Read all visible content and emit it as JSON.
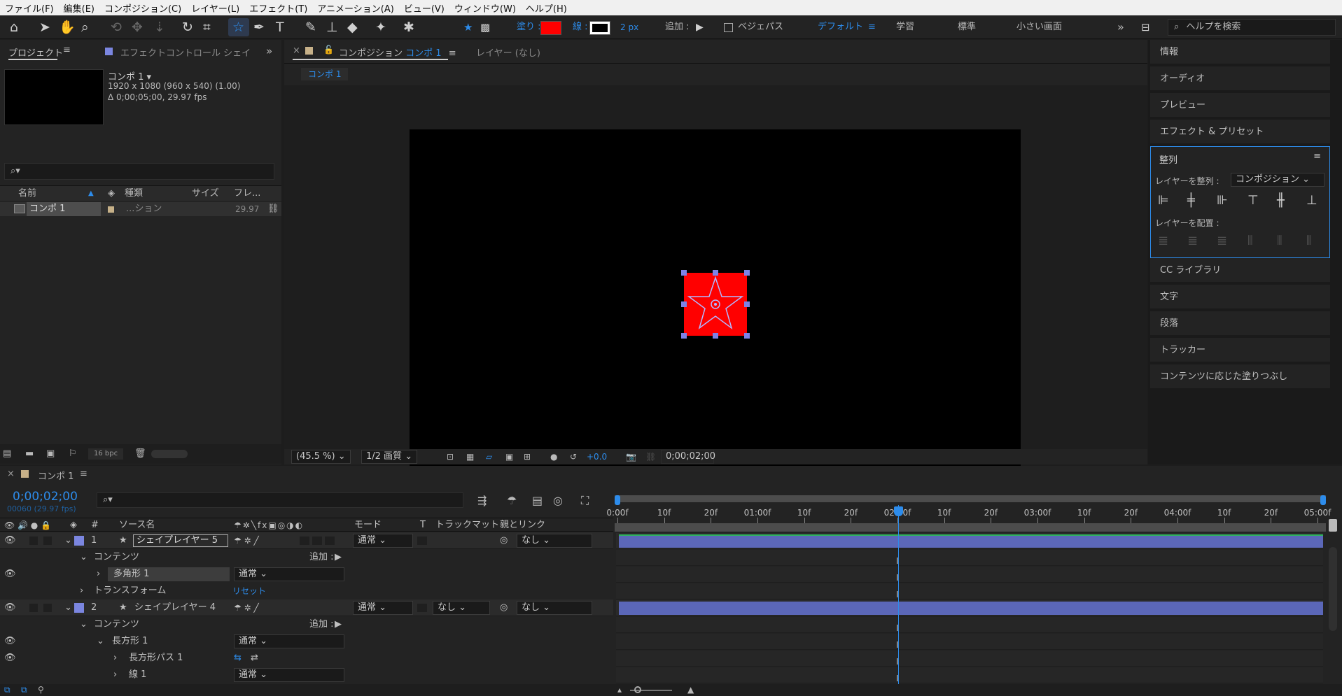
{
  "menu": [
    "ファイル(F)",
    "編集(E)",
    "コンポジション(C)",
    "レイヤー(L)",
    "エフェクト(T)",
    "アニメーション(A)",
    "ビュー(V)",
    "ウィンドウ(W)",
    "ヘルプ(H)"
  ],
  "toolbar": {
    "fill_label": "塗り :",
    "stroke_label": "線 :",
    "stroke_width": "2 px",
    "add_label": "追加 :",
    "bezier_label": "ベジェパス",
    "workspace_default": "デフォルト",
    "workspace_learn": "学習",
    "workspace_standard": "標準",
    "workspace_small": "小さい画面",
    "help_placeholder": "ヘルプを検索",
    "fill_color": "#ff0000",
    "stroke_color": "#000000"
  },
  "project": {
    "tab_label": "プロジェクト",
    "effect_tab": "エフェクトコントロール シェイプレ",
    "comp_name": "コンポ 1",
    "comp_dims": "1920 x 1080  (960 x 540) (1.00)",
    "comp_duration": "Δ 0;00;05;00, 29.97 fps",
    "col_name": "名前",
    "col_type": "種類",
    "col_size": "サイズ",
    "col_frame": "フレ...",
    "item_name": "コンポ 1",
    "item_type": "...ション",
    "item_fps": "29.97",
    "bpc": "16 bpc"
  },
  "comp": {
    "tab_label": "コンポジション",
    "tab_comp": "コンポ 1",
    "layer_tab": "レイヤー (なし)",
    "breadcrumb": "コンポ 1",
    "zoom": "(45.5 %)",
    "quality": "1/2 画質",
    "exposure": "+0.0",
    "timecode": "0;00;02;00",
    "shape_fill": "#ff0000"
  },
  "right_panels": [
    "情報",
    "オーディオ",
    "プレビュー",
    "エフェクト & プリセット"
  ],
  "align": {
    "title": "整列",
    "align_to_label": "レイヤーを整列 :",
    "align_to_value": "コンポジション",
    "distribute_label": "レイヤーを配置 :"
  },
  "right_panels_bottom": [
    "CC ライブラリ",
    "文字",
    "段落",
    "トラッカー",
    "コンテンツに応じた塗りつぶし"
  ],
  "timeline": {
    "tab": "コンポ 1",
    "timecode": "0;00;02;00",
    "frames": "00060 (29.97 fps)",
    "col_source": "ソース名",
    "col_mode": "モード",
    "col_t": "T",
    "col_trackmatte": "トラックマット",
    "col_parent": "親とリンク",
    "ruler": [
      "0:00f",
      "10f",
      "20f",
      "01:00f",
      "10f",
      "20f",
      "02:00f",
      "10f",
      "20f",
      "03:00f",
      "10f",
      "20f",
      "04:00f",
      "10f",
      "20f",
      "05:00f"
    ],
    "rows": [
      {
        "num": "1",
        "name": "シェイプレイヤー 5",
        "mode": "通常",
        "parent": "なし"
      },
      {
        "label": "コンテンツ",
        "add": "追加 :"
      },
      {
        "label": "多角形 1",
        "mode": "通常"
      },
      {
        "label": "トランスフォーム",
        "reset": "リセット"
      },
      {
        "num": "2",
        "name": "シェイプレイヤー 4",
        "mode": "通常",
        "trackmatte": "なし",
        "parent": "なし"
      },
      {
        "label": "コンテンツ",
        "add": "追加 :"
      },
      {
        "label": "長方形 1",
        "mode": "通常"
      },
      {
        "label": "長方形パス 1"
      },
      {
        "label": "線 1",
        "mode": "通常"
      }
    ]
  },
  "colors": {
    "accent": "#2d8ceb",
    "layer_bar": "#5b67b8",
    "label": "#7b86e0"
  }
}
